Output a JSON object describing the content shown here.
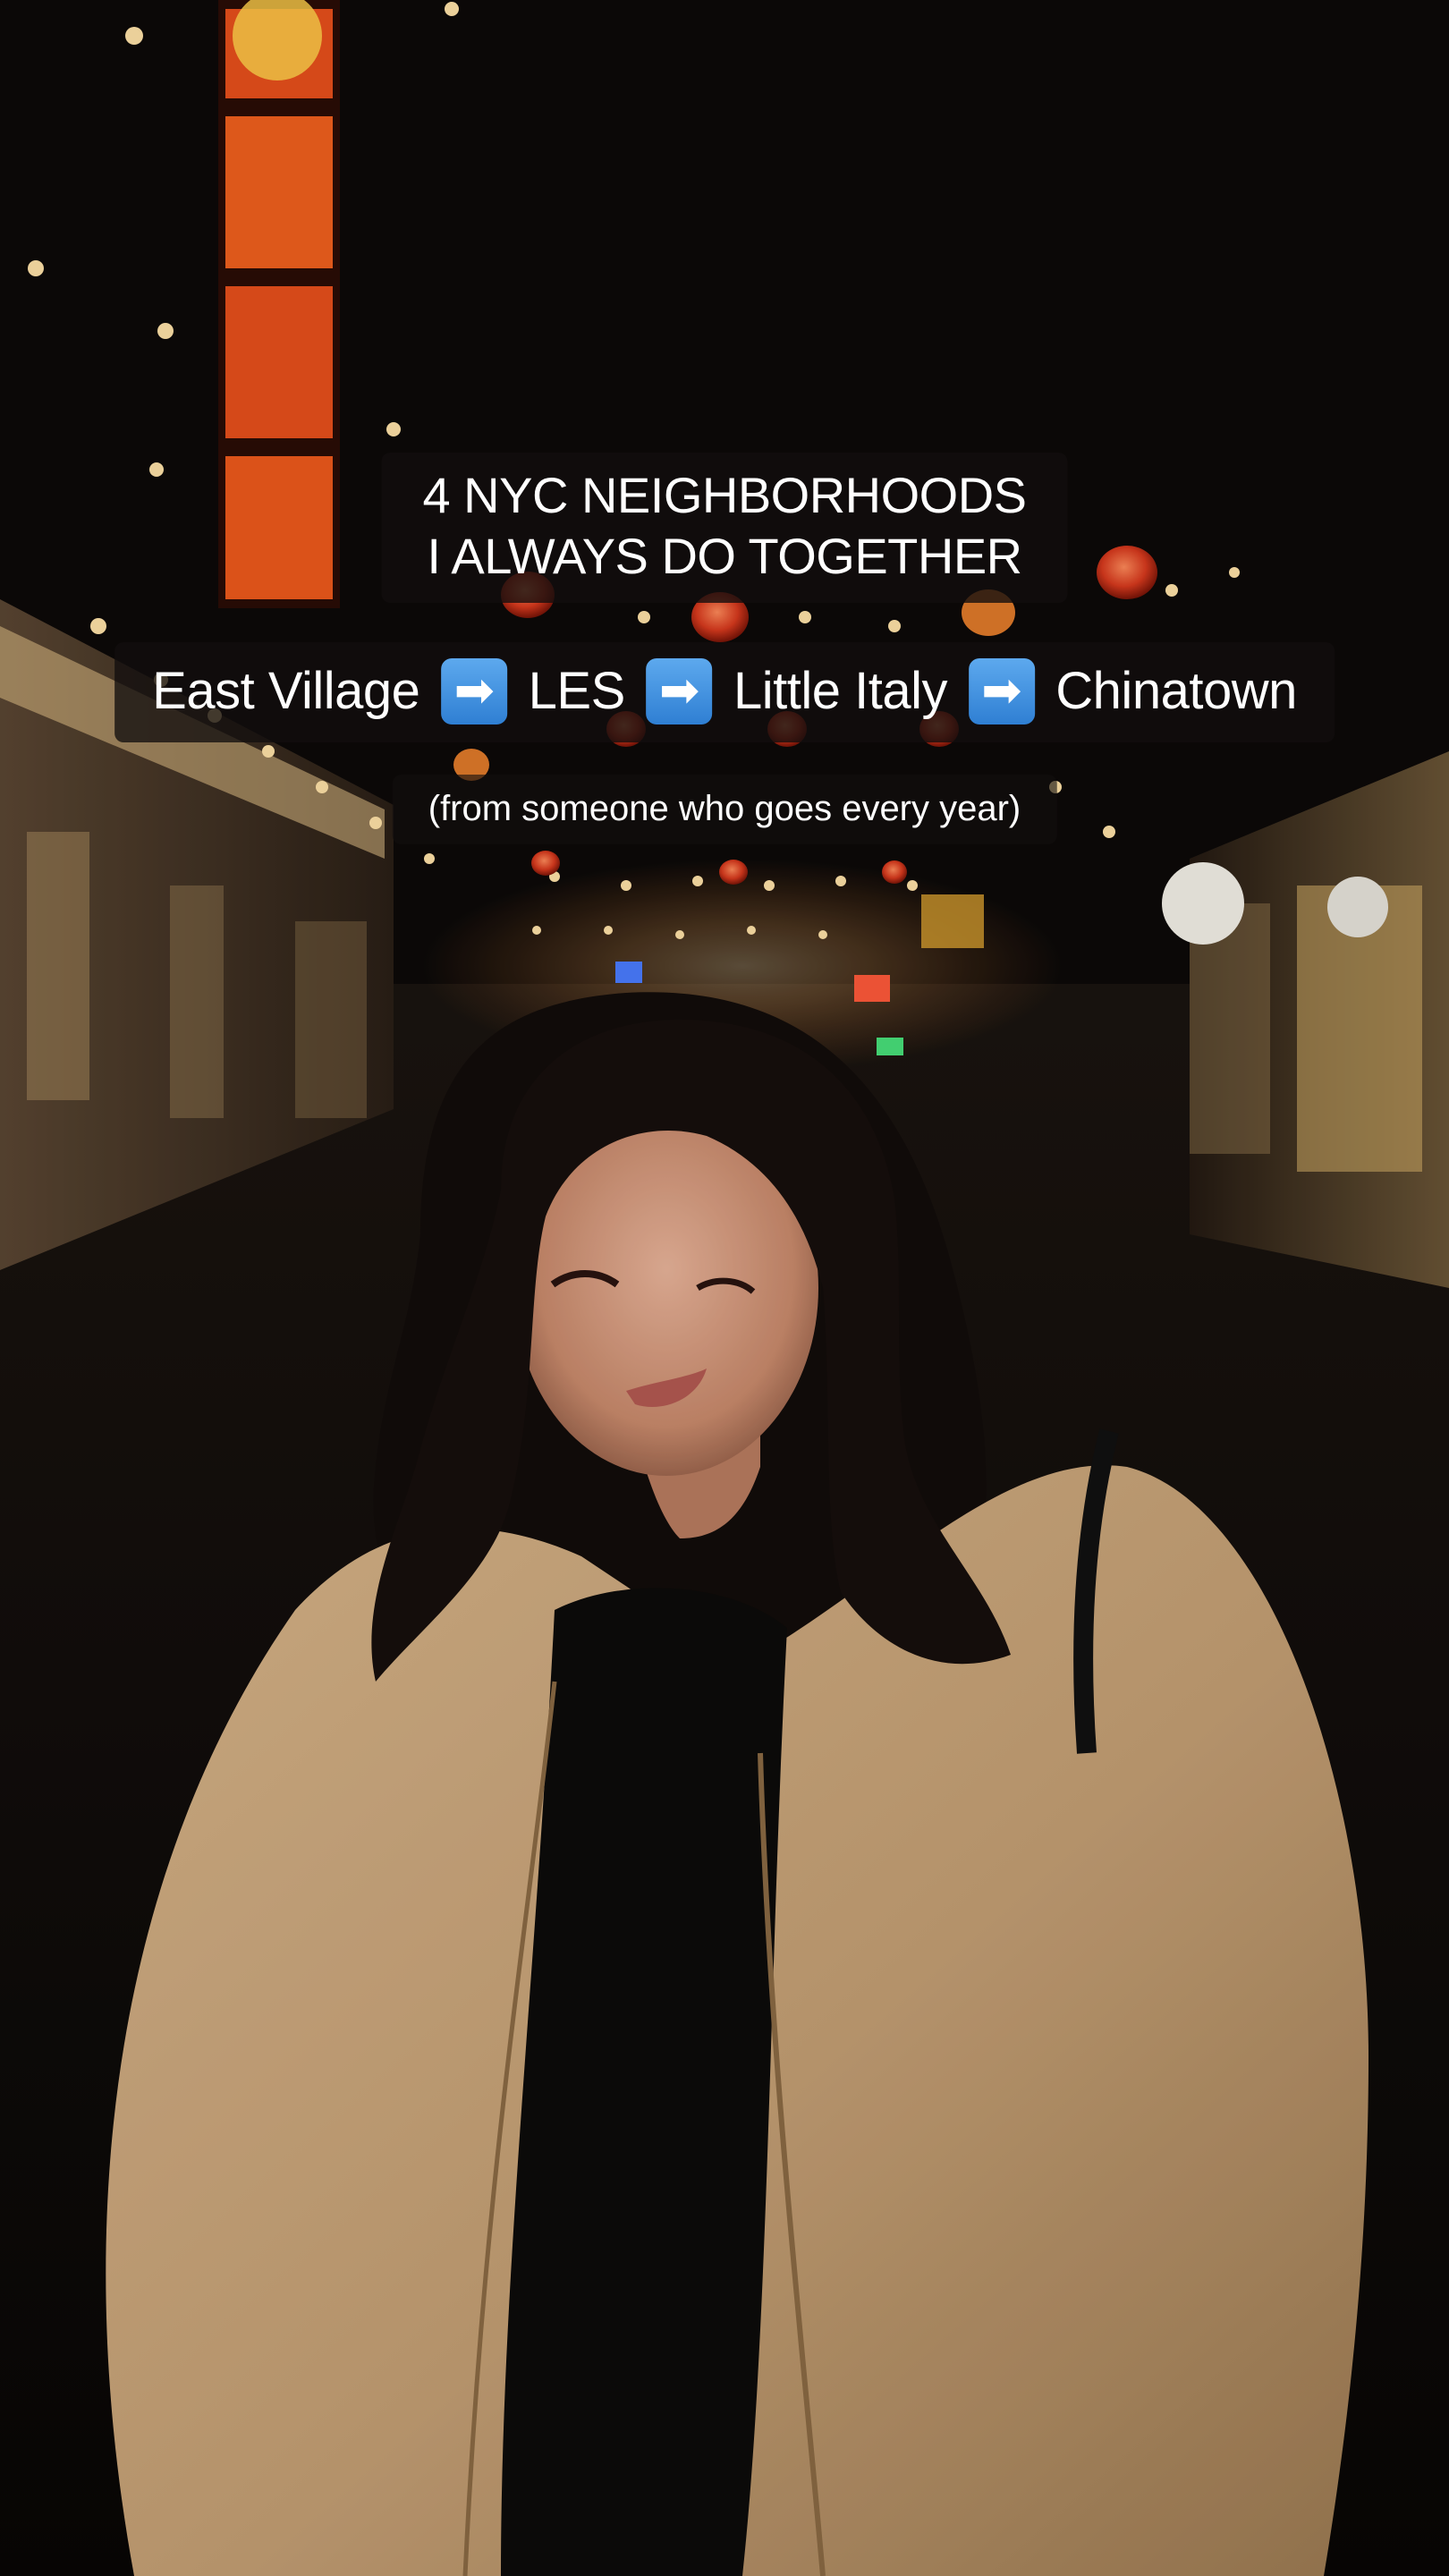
{
  "title_lines": [
    "4 NYC NEIGHBORHOODS",
    "I ALWAYS DO TOGETHER"
  ],
  "route": {
    "stops": [
      "East Village",
      "LES",
      "Little Italy",
      "Chinatown"
    ],
    "arrow_icon": "right-arrow-emoji",
    "arrow_glyph": "➡"
  },
  "subtitle": "(from someone who goes every year)",
  "colors": {
    "caption_bg": "#120e0e",
    "caption_text": "#ffffff",
    "arrow_blue": "#3b8ddc",
    "coat": "#c9a57a",
    "lantern_red": "#d83a1e",
    "sign_orange": "#e8501c"
  }
}
